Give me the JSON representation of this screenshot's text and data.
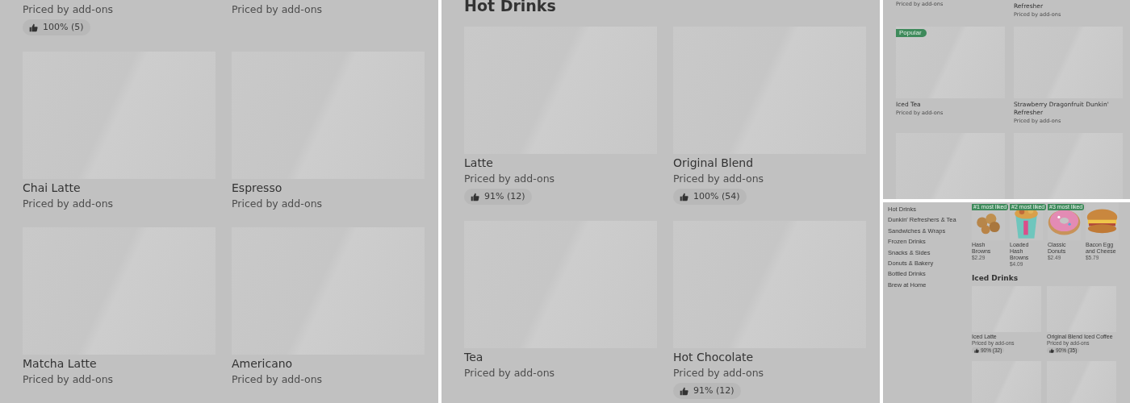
{
  "left_panel": {
    "items": [
      {
        "kind": "text",
        "subtitle": "Priced by add-ons",
        "rating": "100% (5)"
      },
      {
        "kind": "text",
        "subtitle": "Priced by add-ons"
      },
      {
        "kind": "card",
        "title": "Chai Latte",
        "subtitle": "Priced by add-ons"
      },
      {
        "kind": "card",
        "title": "Espresso",
        "subtitle": "Priced by add-ons"
      },
      {
        "kind": "card",
        "title": "Matcha Latte",
        "subtitle": "Priced by add-ons"
      },
      {
        "kind": "card",
        "title": "Americano",
        "subtitle": "Priced by add-ons"
      }
    ]
  },
  "middle_panel": {
    "heading": "Hot Drinks",
    "items": [
      {
        "kind": "card",
        "title": "Latte",
        "subtitle": "Priced by add-ons",
        "rating": "91% (12)"
      },
      {
        "kind": "card",
        "title": "Original Blend",
        "subtitle": "Priced by add-ons",
        "rating": "100% (54)"
      },
      {
        "kind": "card",
        "title": "Tea",
        "subtitle": "Priced by add-ons"
      },
      {
        "kind": "card",
        "title": "Hot Chocolate",
        "subtitle": "Priced by add-ons",
        "rating": "91% (12)"
      }
    ]
  },
  "top_right_panel": {
    "items": [
      {
        "kind": "text",
        "subtitle": "Priced by add-ons"
      },
      {
        "kind": "text",
        "title": "Refresher",
        "subtitle": "Priced by add-ons"
      },
      {
        "kind": "card",
        "badge": "Popular",
        "title": "Iced Tea",
        "subtitle": "Priced by add-ons"
      },
      {
        "kind": "card",
        "title": "Strawberry Dragonfruit Dunkin' Refresher",
        "subtitle": "Priced by add-ons"
      },
      {
        "kind": "card"
      },
      {
        "kind": "card"
      }
    ]
  },
  "bottom_right_panel": {
    "sidebar": {
      "items": [
        {
          "label": "Hot Drinks"
        },
        {
          "label": "Dunkin' Refreshers & Tea"
        },
        {
          "label": "Sandwiches & Wraps"
        },
        {
          "label": "Frozen Drinks"
        },
        {
          "label": "Snacks & Sides"
        },
        {
          "label": "Donuts & Bakery"
        },
        {
          "label": "Bottled Drinks"
        },
        {
          "label": "Brew at Home"
        }
      ]
    },
    "featured": [
      {
        "kind": "picture",
        "badge": "#1 most liked",
        "title": "Hash Browns",
        "price": "$2.29"
      },
      {
        "kind": "picture",
        "badge": "#2 most liked",
        "title": "Loaded Hash Browns",
        "price": "$4.09"
      },
      {
        "kind": "picture",
        "badge": "#3 most liked",
        "title": "Classic Donuts",
        "price": "$2.49"
      },
      {
        "kind": "picture",
        "title": "Bacon Egg and Cheese",
        "price": "$5.79"
      }
    ],
    "heading": "Iced Drinks",
    "items": [
      {
        "kind": "card",
        "title": "Iced Latte",
        "subtitle": "Priced by add-ons",
        "rating": "90% (32)"
      },
      {
        "kind": "card",
        "title": "Original Blend Iced Coffee",
        "subtitle": "Priced by add-ons",
        "rating": "90% (35)"
      },
      {
        "kind": "card"
      },
      {
        "kind": "card"
      }
    ]
  }
}
